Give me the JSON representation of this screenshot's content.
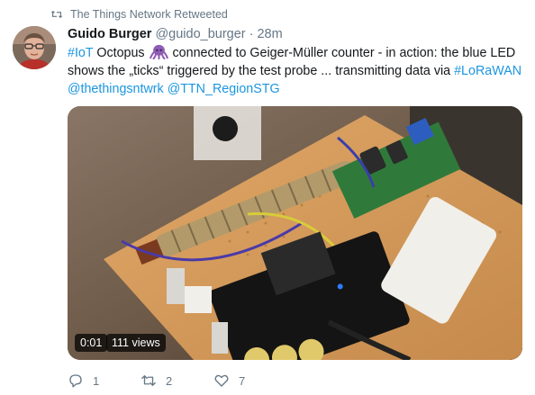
{
  "retweet_context": {
    "label": "The Things Network Retweeted",
    "icon": "retweet-icon"
  },
  "author": {
    "display_name": "Guido Burger",
    "handle": "@guido_burger",
    "separator": "·",
    "time": "28m"
  },
  "tweet": {
    "seg1": "#IoT",
    "seg2": " Octopus ",
    "seg3": " connected to Geiger-Müller counter - in action: the blue LED shows the „ticks“ triggered by the test probe ... transmitting data via ",
    "seg4": "#LoRaWAN",
    "seg5": "@thethingsntwrk",
    "seg6": " ",
    "seg7": "@TTN_RegionSTG"
  },
  "media": {
    "duration": "0:01",
    "views": "111 views"
  },
  "actions": {
    "replies": "1",
    "retweets": "2",
    "likes": "7"
  },
  "colors": {
    "link": "#1b95e0",
    "muted": "#657786",
    "text": "#14171a"
  }
}
